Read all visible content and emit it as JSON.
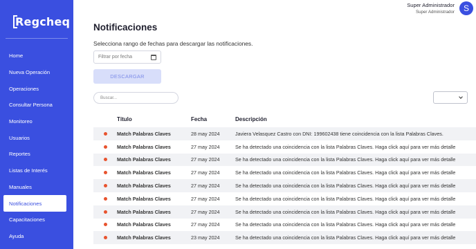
{
  "sidebar": {
    "logo": "Regcheq",
    "items": [
      {
        "label": "Home"
      },
      {
        "label": "Nueva Operación"
      },
      {
        "label": "Operaciones"
      },
      {
        "label": "Consultar Persona"
      },
      {
        "label": "Monitoreo"
      },
      {
        "label": "Usuarios"
      },
      {
        "label": "Reportes"
      },
      {
        "label": "Listas de Interés"
      },
      {
        "label": "Manuales"
      },
      {
        "label": "Notificaciones",
        "active": true
      },
      {
        "label": "Capacitaciones"
      },
      {
        "label": "Ayuda"
      }
    ]
  },
  "header": {
    "user_name": "Super Administrador",
    "user_role": "Super Administrador",
    "avatar_letter": "S"
  },
  "main": {
    "title": "Notificaciones",
    "subtitle": "Selecciona rango de fechas para descargar las notificaciones.",
    "date_placeholder": "Filtrar por fecha",
    "download_label": "DESCARGAR",
    "search_placeholder": "Buscar..."
  },
  "table": {
    "headers": {
      "title": "Título",
      "date": "Fecha",
      "desc": "Descripción"
    },
    "rows": [
      {
        "title": "Match Palabras Claves",
        "date": "28 may 2024",
        "desc": "Javiera Velasquez Castro con DNI: 199602438 tiene coincidencia con la lista Palabras Claves."
      },
      {
        "title": "Match Palabras Claves",
        "date": "27 may 2024",
        "desc": "Se ha detectado una coincidencia con la lista Palabras Claves. Haga click aquí para ver más detalle"
      },
      {
        "title": "Match Palabras Claves",
        "date": "27 may 2024",
        "desc": "Se ha detectado una coincidencia con la lista Palabras Claves. Haga click aquí para ver más detalle"
      },
      {
        "title": "Match Palabras Claves",
        "date": "27 may 2024",
        "desc": "Se ha detectado una coincidencia con la lista Palabras Claves. Haga click aquí para ver más detalle"
      },
      {
        "title": "Match Palabras Claves",
        "date": "27 may 2024",
        "desc": "Se ha detectado una coincidencia con la lista Palabras Claves. Haga click aquí para ver más detalle"
      },
      {
        "title": "Match Palabras Claves",
        "date": "27 may 2024",
        "desc": "Se ha detectado una coincidencia con la lista Palabras Claves. Haga click aquí para ver más detalle"
      },
      {
        "title": "Match Palabras Claves",
        "date": "27 may 2024",
        "desc": "Se ha detectado una coincidencia con la lista Palabras Claves. Haga click aquí para ver más detalle"
      },
      {
        "title": "Match Palabras Claves",
        "date": "27 may 2024",
        "desc": "Se ha detectado una coincidencia con la lista Palabras Claves. Haga click aquí para ver más detalle"
      },
      {
        "title": "Match Palabras Claves",
        "date": "23 may 2024",
        "desc": "Se ha detectado una coincidencia con la lista Palabras Claves. Haga click aquí para ver más detalle"
      }
    ]
  },
  "colors": {
    "sidebar_bg": "#3a4fe0",
    "status_dot": "#e8532e",
    "button_bg": "#d8defa"
  },
  "icons": {
    "calendar": "calendar-icon",
    "chevron": "chevron-down-icon",
    "status": "status-dot-icon"
  }
}
